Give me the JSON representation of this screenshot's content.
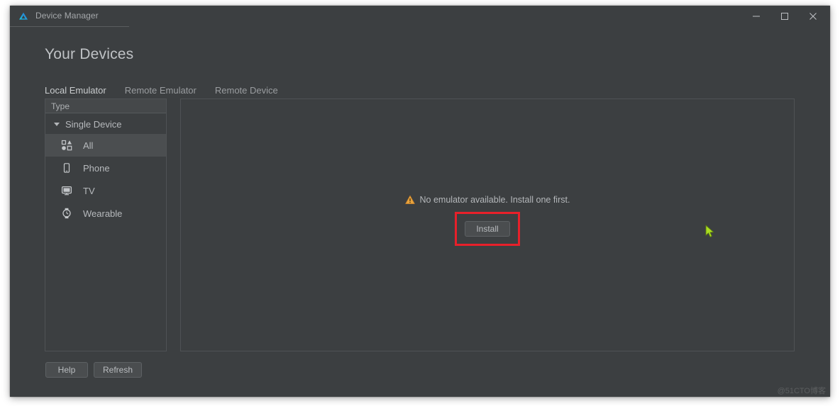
{
  "window": {
    "title": "Device Manager",
    "logo_icon": "deveco-triangle-logo",
    "controls": [
      {
        "name": "minimize",
        "icon": "minimize-icon"
      },
      {
        "name": "maximize",
        "icon": "maximize-icon"
      },
      {
        "name": "close",
        "icon": "close-icon"
      }
    ]
  },
  "header": {
    "page_title": "Your Devices"
  },
  "tabs": [
    {
      "label": "Local Emulator",
      "active": true
    },
    {
      "label": "Remote Emulator",
      "active": false
    },
    {
      "label": "Remote Device",
      "active": false
    }
  ],
  "sidebar": {
    "column_header": "Type",
    "group": {
      "label": "Single Device",
      "expanded": true,
      "toggle_icon": "chevron-down-icon"
    },
    "items": [
      {
        "label": "All",
        "icon": "shapes-grid-icon",
        "selected": true
      },
      {
        "label": "Phone",
        "icon": "phone-icon",
        "selected": false
      },
      {
        "label": "TV",
        "icon": "tv-icon",
        "selected": false
      },
      {
        "label": "Wearable",
        "icon": "watch-icon",
        "selected": false
      }
    ]
  },
  "footer": {
    "help_label": "Help",
    "refresh_label": "Refresh"
  },
  "content": {
    "empty_state": {
      "warning_icon": "warning-triangle-icon",
      "message": "No emulator available. Install one first.",
      "install_label": "Install"
    }
  },
  "annotation": {
    "highlight_color": "#e8202a",
    "target": "install-button"
  },
  "colors": {
    "window_bg": "#3c3f41",
    "panel_border": "#4f5255",
    "accent_tab_underline": "#4f86c6",
    "selected_row": "#4b4e50",
    "warning": "#e8a33d",
    "cursor": "#aadd22"
  },
  "watermark": {
    "text": "@51CTO博客"
  }
}
